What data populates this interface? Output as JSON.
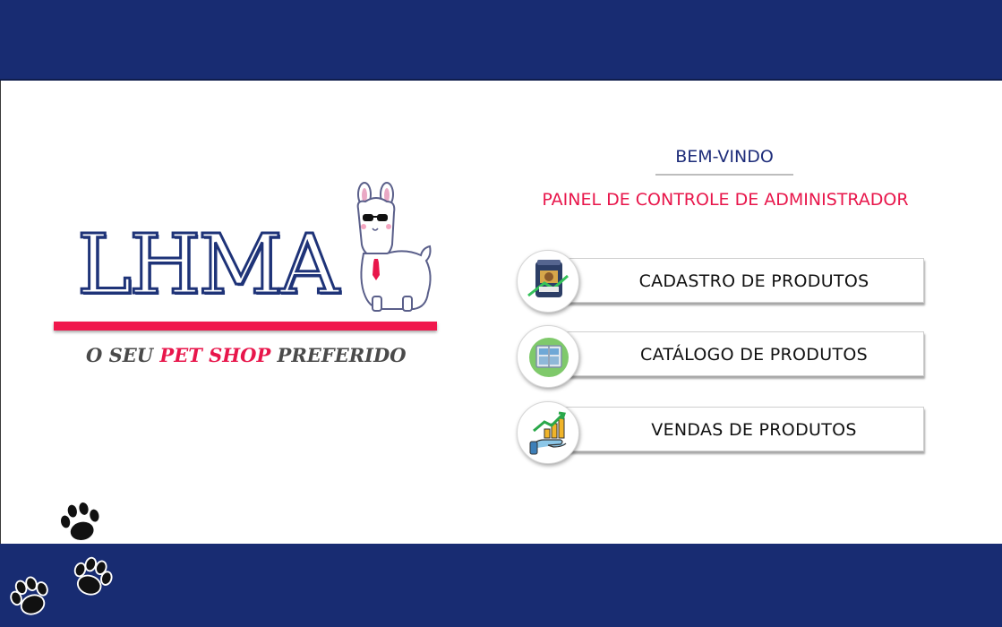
{
  "brand": {
    "logo_text": "LHMA",
    "tagline_prefix": "O SEU ",
    "tagline_accent": "PET SHOP",
    "tagline_suffix": " PREFERIDO"
  },
  "header": {
    "welcome": "BEM-VINDO",
    "panel_title": "PAINEL DE CONTROLE DE ADMINISTRADOR"
  },
  "menu": {
    "items": [
      {
        "label": "CADASTRO DE PRODUTOS",
        "icon": "product-bag-icon"
      },
      {
        "label": "CATÁLOGO DE PRODUTOS",
        "icon": "catalog-icon"
      },
      {
        "label": "VENDAS DE PRODUTOS",
        "icon": "sales-growth-icon"
      }
    ]
  },
  "colors": {
    "navy": "#182c72",
    "accent_red": "#e8164b",
    "text_dark": "#111111"
  },
  "decor": {
    "llama": "llama-mascot-icon",
    "paws": "paw-print-icon"
  }
}
